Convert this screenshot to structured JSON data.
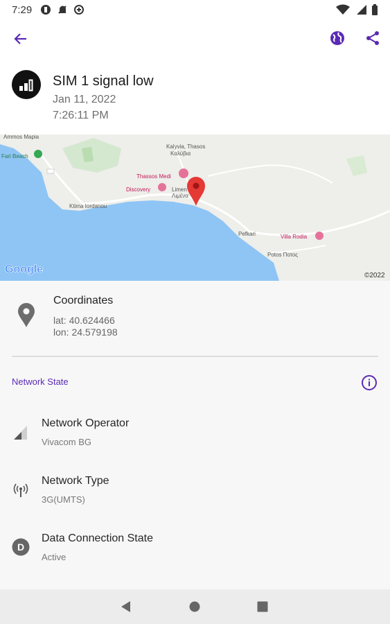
{
  "status_bar": {
    "time": "7:29"
  },
  "event": {
    "title": "SIM 1 signal low",
    "date": "Jan 11, 2022",
    "time": "7:26:11 PM"
  },
  "map": {
    "google_logo": "Google",
    "copyright": "©2022",
    "labels": [
      "Fari Beach",
      "Thassos Medi",
      "Discovery",
      "Villa Rodia",
      "Kalyvia, Thasos",
      "Kαλύβια",
      "Ktima Iordanou",
      "Limen",
      "Λιμένα",
      "Pefkari",
      "Potos Ποτος",
      "Ammos Mapia"
    ]
  },
  "coordinates": {
    "title": "Coordinates",
    "lat": "lat: 40.624466",
    "lon": "lon: 24.579198"
  },
  "network": {
    "section_title": "Network State",
    "operator": {
      "title": "Network Operator",
      "value": "Vivacom BG"
    },
    "type": {
      "title": "Network Type",
      "value": "3G(UMTS)"
    },
    "data_state": {
      "title": "Data Connection State",
      "value": "Active"
    }
  },
  "colors": {
    "accent": "#5b2ab5",
    "marker": "#e53935",
    "sea": "#8ec5f5",
    "land": "#eeeeea"
  }
}
